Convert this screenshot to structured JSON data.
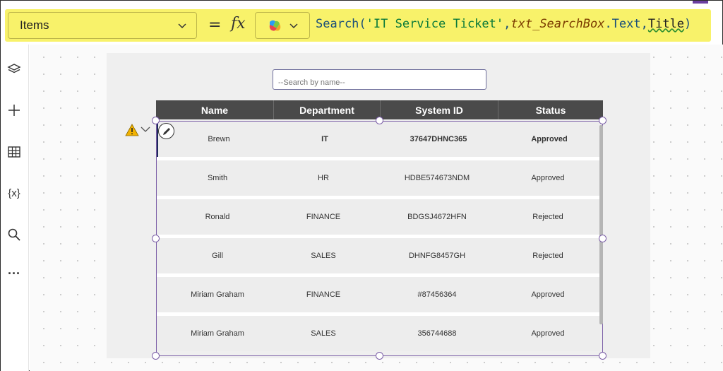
{
  "formula_bar": {
    "property": "Items",
    "equals": "=",
    "fx": "fx",
    "formula_parts": {
      "fn_open": "Search(",
      "source": "'IT Service Ticket'",
      "comma1": ",",
      "control": "txt_SearchBox",
      "dot_text": ".Text,",
      "column": "Title",
      "close": ")"
    },
    "icons": [
      "chevron-down-icon",
      "copilot-icon"
    ]
  },
  "rail": {
    "icons": [
      "layers-icon",
      "plus-icon",
      "table-icon",
      "variables-icon",
      "search-icon",
      "more-icon"
    ],
    "variables_label": "{x}",
    "more_label": "···"
  },
  "search": {
    "placeholder": "--Search by name--"
  },
  "table": {
    "headers": [
      "Name",
      "Department",
      "System ID",
      "Status"
    ],
    "rows": [
      {
        "name": "Brewn",
        "department": "IT",
        "system_id": "37647DHNC365",
        "status": "Approved"
      },
      {
        "name": "Smith",
        "department": "HR",
        "system_id": "HDBE574673NDM",
        "status": "Approved"
      },
      {
        "name": "Ronald",
        "department": "FINANCE",
        "system_id": "BDGSJ4672HFN",
        "status": "Rejected"
      },
      {
        "name": "Gill",
        "department": "SALES",
        "system_id": "DHNFG8457GH",
        "status": "Rejected"
      },
      {
        "name": "Miriam Graham",
        "department": "FINANCE",
        "system_id": "#87456364",
        "status": "Approved"
      },
      {
        "name": "Miriam Graham",
        "department": "SALES",
        "system_id": "356744688",
        "status": "Approved"
      }
    ]
  },
  "colors": {
    "formula_bar_bg": "#f8f26a",
    "header_bg": "#4a4a4a",
    "selection": "#7b5ea7",
    "warning": "#f2b200"
  }
}
